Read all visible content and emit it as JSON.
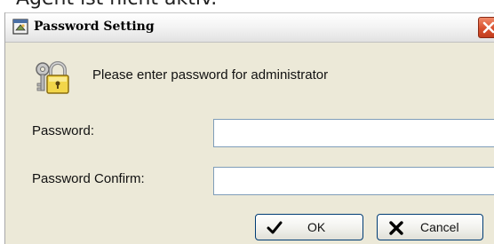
{
  "background": {
    "partial_text": "Agent ist nicht aktiv."
  },
  "window": {
    "title": "Password Setting",
    "title_icon": "dialog-icon",
    "close_icon": "close-icon"
  },
  "header": {
    "icon": "padlock-keys-icon",
    "message": "Please enter password for administrator"
  },
  "form": {
    "password_label": "Password:",
    "password_value": "",
    "confirm_label": "Password Confirm:",
    "confirm_value": ""
  },
  "buttons": {
    "ok_label": "OK",
    "ok_icon": "checkmark-icon",
    "cancel_label": "Cancel",
    "cancel_icon": "x-icon"
  },
  "colors": {
    "dialog_bg": "#ece9d8",
    "close_button": "#d8502e",
    "input_border": "#7f9db9",
    "button_border": "#003c74"
  }
}
